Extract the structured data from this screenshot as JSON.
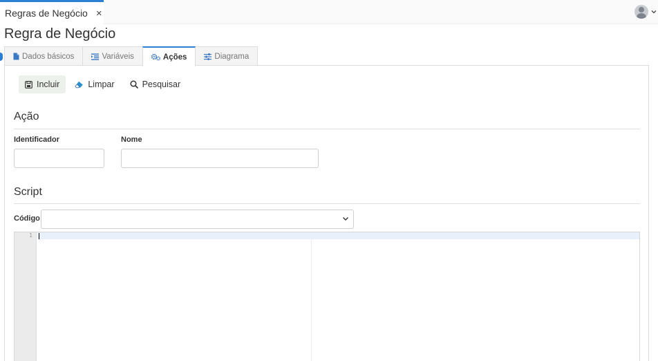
{
  "tab": {
    "title": "Regras de Negócio",
    "close_icon": "×"
  },
  "user": {
    "avatar_icon": "user-avatar-icon",
    "caret": "⌄"
  },
  "page": {
    "title": "Regra de Negócio"
  },
  "tabs": [
    {
      "label": "Dados básicos",
      "icon": "file-icon"
    },
    {
      "label": "Variáveis",
      "icon": "list-indent-icon"
    },
    {
      "label": "Ações",
      "icon": "gears-icon",
      "active": true
    },
    {
      "label": "Diagrama",
      "icon": "sliders-icon"
    }
  ],
  "toolbar": {
    "include": "Incluir",
    "clear": "Limpar",
    "search": "Pesquisar"
  },
  "acao": {
    "title": "Ação",
    "identificador_label": "Identificador",
    "identificador_value": "",
    "nome_label": "Nome",
    "nome_value": ""
  },
  "script": {
    "title": "Script",
    "codigo_label": "Código",
    "codigo_value": "",
    "editor": {
      "line_numbers": [
        "1"
      ],
      "content": ""
    }
  },
  "colors": {
    "accent": "#2a7fd4",
    "primary_button_bg": "#edf1ec",
    "active_line": "#e8f0fc"
  }
}
